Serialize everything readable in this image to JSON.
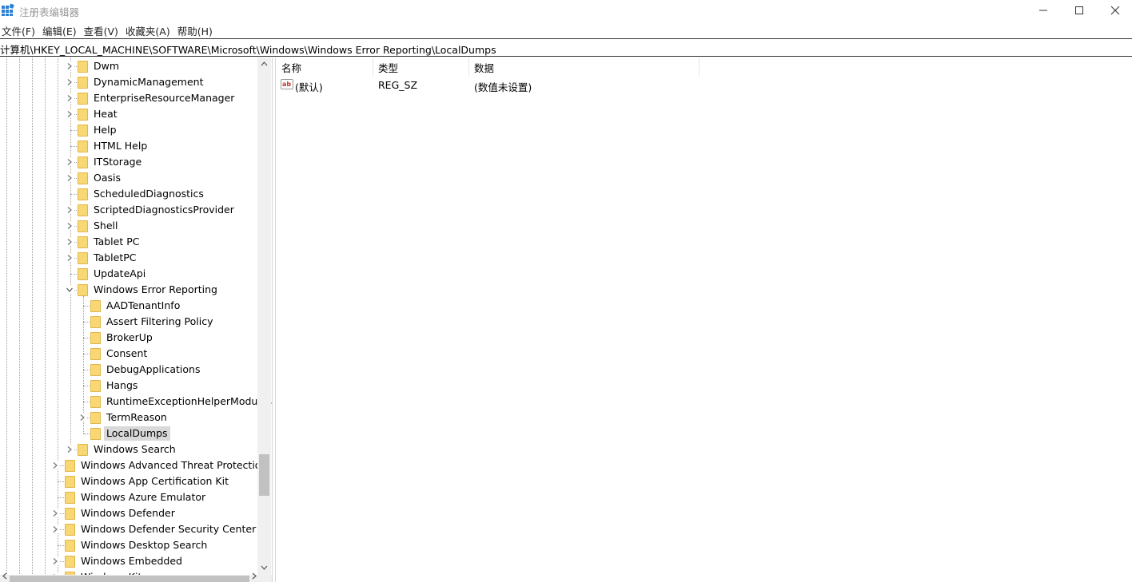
{
  "window": {
    "title": "注册表编辑器",
    "controls": {
      "minimize": "—",
      "maximize": "☐",
      "close": "✕"
    }
  },
  "menu": [
    "文件(F)",
    "编辑(E)",
    "查看(V)",
    "收藏夹(A)",
    "帮助(H)"
  ],
  "address": "计算机\\HKEY_LOCAL_MACHINE\\SOFTWARE\\Microsoft\\Windows\\Windows Error Reporting\\LocalDumps",
  "tree": {
    "items": [
      {
        "label": "Dwm",
        "level": 1,
        "expander": "collapsed"
      },
      {
        "label": "DynamicManagement",
        "level": 1,
        "expander": "collapsed"
      },
      {
        "label": "EnterpriseResourceManager",
        "level": 1,
        "expander": "collapsed"
      },
      {
        "label": "Heat",
        "level": 1,
        "expander": "collapsed"
      },
      {
        "label": "Help",
        "level": 1,
        "expander": "none"
      },
      {
        "label": "HTML Help",
        "level": 1,
        "expander": "none"
      },
      {
        "label": "ITStorage",
        "level": 1,
        "expander": "collapsed"
      },
      {
        "label": "Oasis",
        "level": 1,
        "expander": "collapsed"
      },
      {
        "label": "ScheduledDiagnostics",
        "level": 1,
        "expander": "none"
      },
      {
        "label": "ScriptedDiagnosticsProvider",
        "level": 1,
        "expander": "collapsed"
      },
      {
        "label": "Shell",
        "level": 1,
        "expander": "collapsed"
      },
      {
        "label": "Tablet PC",
        "level": 1,
        "expander": "collapsed"
      },
      {
        "label": "TabletPC",
        "level": 1,
        "expander": "collapsed"
      },
      {
        "label": "UpdateApi",
        "level": 1,
        "expander": "none"
      },
      {
        "label": "Windows Error Reporting",
        "level": 1,
        "expander": "expanded"
      },
      {
        "label": "AADTenantInfo",
        "level": 2,
        "expander": "none"
      },
      {
        "label": "Assert Filtering Policy",
        "level": 2,
        "expander": "none"
      },
      {
        "label": "BrokerUp",
        "level": 2,
        "expander": "none"
      },
      {
        "label": "Consent",
        "level": 2,
        "expander": "none"
      },
      {
        "label": "DebugApplications",
        "level": 2,
        "expander": "none"
      },
      {
        "label": "Hangs",
        "level": 2,
        "expander": "none"
      },
      {
        "label": "RuntimeExceptionHelperModules",
        "level": 2,
        "expander": "none"
      },
      {
        "label": "TermReason",
        "level": 2,
        "expander": "collapsed"
      },
      {
        "label": "LocalDumps",
        "level": 2,
        "expander": "none",
        "selected": true
      },
      {
        "label": "Windows Search",
        "level": 1,
        "expander": "collapsed"
      },
      {
        "label": "Windows Advanced Threat Protection",
        "level": 0,
        "expander": "collapsed"
      },
      {
        "label": "Windows App Certification Kit",
        "level": 0,
        "expander": "none"
      },
      {
        "label": "Windows Azure Emulator",
        "level": 0,
        "expander": "none"
      },
      {
        "label": "Windows Defender",
        "level": 0,
        "expander": "collapsed"
      },
      {
        "label": "Windows Defender Security Center",
        "level": 0,
        "expander": "collapsed"
      },
      {
        "label": "Windows Desktop Search",
        "level": 0,
        "expander": "none"
      },
      {
        "label": "Windows Embedded",
        "level": 0,
        "expander": "collapsed"
      },
      {
        "label": "Windows Kits",
        "level": 0,
        "expander": "collapsed"
      }
    ]
  },
  "list": {
    "columns": [
      "名称",
      "类型",
      "数据"
    ],
    "rows": [
      {
        "icon": "string-value-icon",
        "name": "(默认)",
        "type": "REG_SZ",
        "data": "(数值未设置)"
      }
    ]
  }
}
